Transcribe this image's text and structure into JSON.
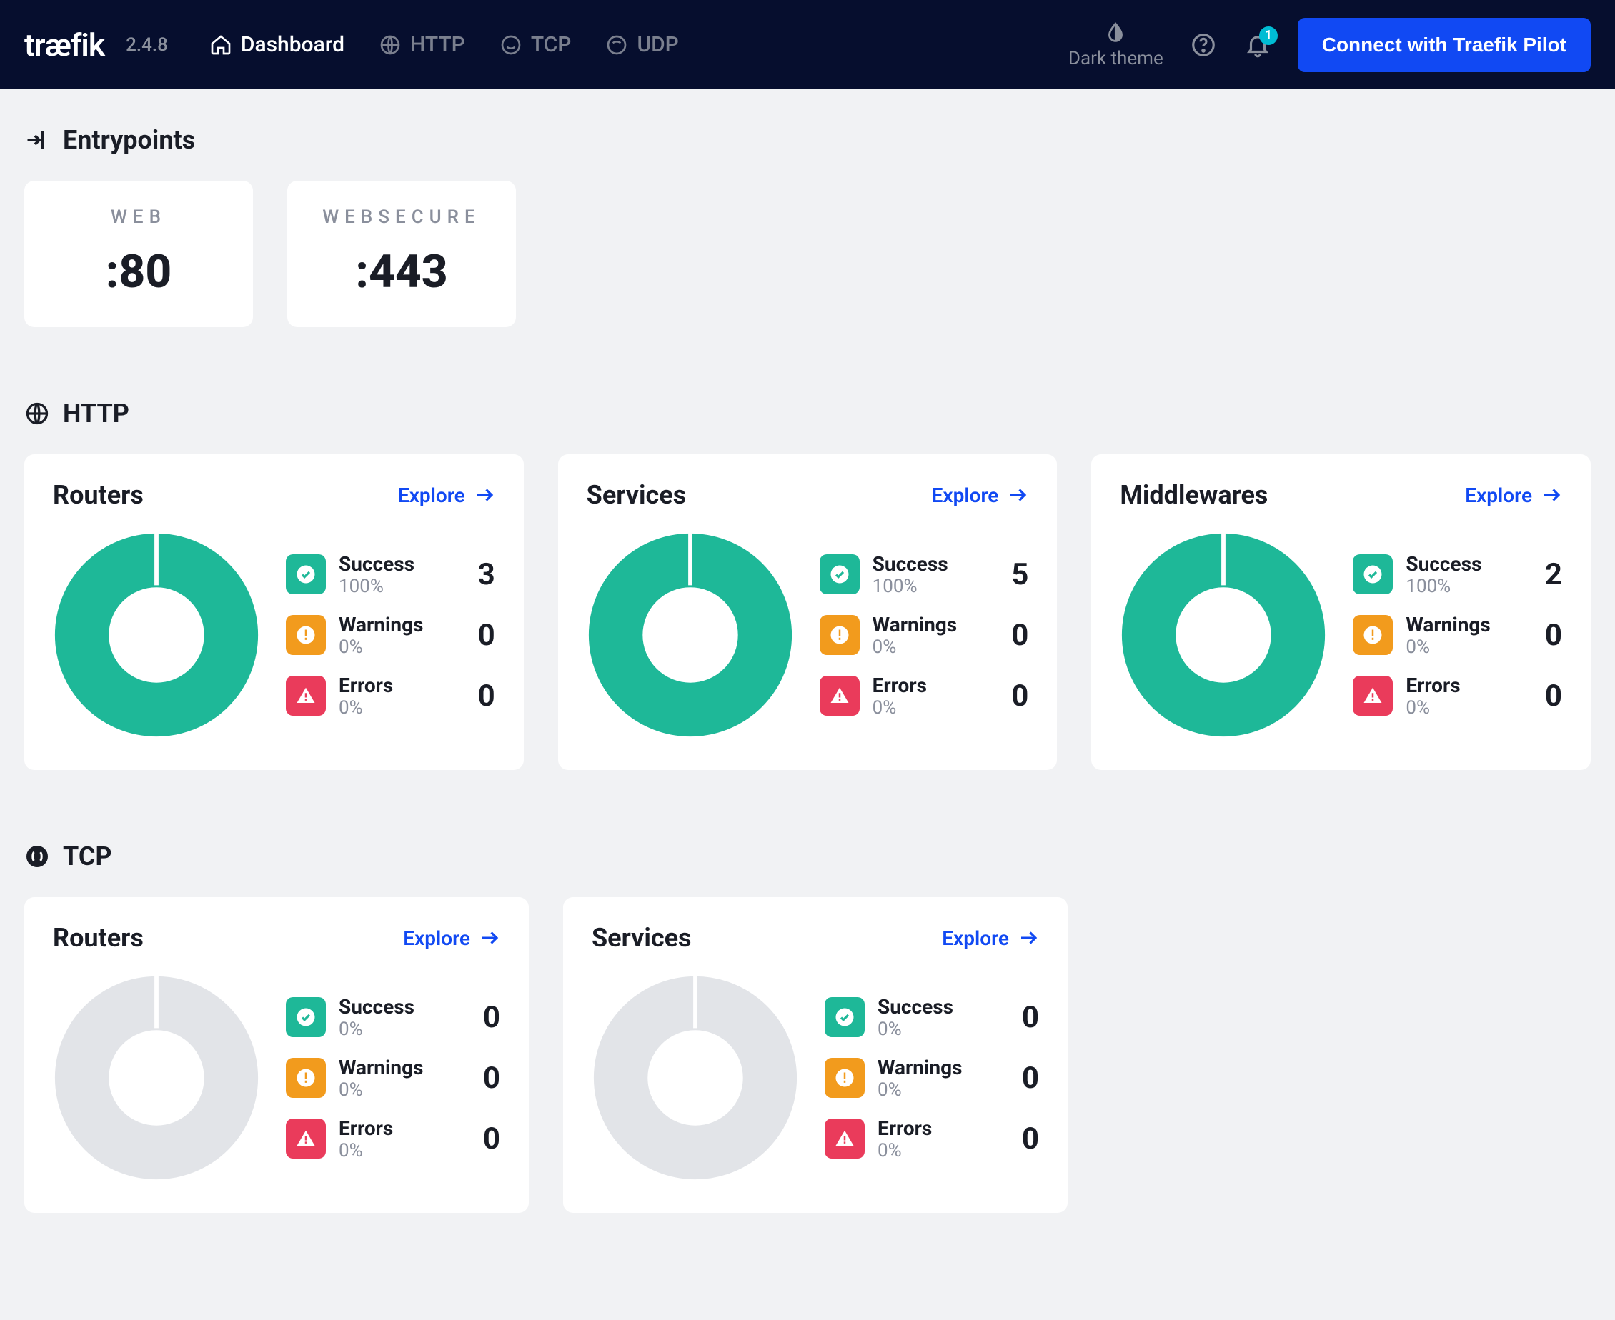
{
  "header": {
    "logo": "træfik",
    "version": "2.4.8",
    "nav": {
      "dashboard": "Dashboard",
      "http": "HTTP",
      "tcp": "TCP",
      "udp": "UDP"
    },
    "theme_label": "Dark theme",
    "notifications_badge": "1",
    "pilot_button": "Connect with Traefik Pilot"
  },
  "sections": {
    "entrypoints": {
      "title": "Entrypoints",
      "items": [
        {
          "name": "WEB",
          "port": ":80"
        },
        {
          "name": "WEBSECURE",
          "port": ":443"
        }
      ]
    },
    "http": {
      "title": "HTTP",
      "cards": [
        {
          "title": "Routers",
          "explore": "Explore",
          "success_label": "Success",
          "success_pct": "100%",
          "success_count": "3",
          "warnings_label": "Warnings",
          "warnings_pct": "0%",
          "warnings_count": "0",
          "errors_label": "Errors",
          "errors_pct": "0%",
          "errors_count": "0",
          "donut_color": "#1eb898"
        },
        {
          "title": "Services",
          "explore": "Explore",
          "success_label": "Success",
          "success_pct": "100%",
          "success_count": "5",
          "warnings_label": "Warnings",
          "warnings_pct": "0%",
          "warnings_count": "0",
          "errors_label": "Errors",
          "errors_pct": "0%",
          "errors_count": "0",
          "donut_color": "#1eb898"
        },
        {
          "title": "Middlewares",
          "explore": "Explore",
          "success_label": "Success",
          "success_pct": "100%",
          "success_count": "2",
          "warnings_label": "Warnings",
          "warnings_pct": "0%",
          "warnings_count": "0",
          "errors_label": "Errors",
          "errors_pct": "0%",
          "errors_count": "0",
          "donut_color": "#1eb898"
        }
      ]
    },
    "tcp": {
      "title": "TCP",
      "cards": [
        {
          "title": "Routers",
          "explore": "Explore",
          "success_label": "Success",
          "success_pct": "0%",
          "success_count": "0",
          "warnings_label": "Warnings",
          "warnings_pct": "0%",
          "warnings_count": "0",
          "errors_label": "Errors",
          "errors_pct": "0%",
          "errors_count": "0",
          "donut_color": "#e2e4e8"
        },
        {
          "title": "Services",
          "explore": "Explore",
          "success_label": "Success",
          "success_pct": "0%",
          "success_count": "0",
          "warnings_label": "Warnings",
          "warnings_pct": "0%",
          "warnings_count": "0",
          "errors_label": "Errors",
          "errors_pct": "0%",
          "errors_count": "0",
          "donut_color": "#e2e4e8"
        }
      ]
    }
  },
  "chart_data": [
    {
      "type": "pie",
      "title": "HTTP Routers",
      "categories": [
        "Success",
        "Warnings",
        "Errors"
      ],
      "values": [
        3,
        0,
        0
      ]
    },
    {
      "type": "pie",
      "title": "HTTP Services",
      "categories": [
        "Success",
        "Warnings",
        "Errors"
      ],
      "values": [
        5,
        0,
        0
      ]
    },
    {
      "type": "pie",
      "title": "HTTP Middlewares",
      "categories": [
        "Success",
        "Warnings",
        "Errors"
      ],
      "values": [
        2,
        0,
        0
      ]
    },
    {
      "type": "pie",
      "title": "TCP Routers",
      "categories": [
        "Success",
        "Warnings",
        "Errors"
      ],
      "values": [
        0,
        0,
        0
      ]
    },
    {
      "type": "pie",
      "title": "TCP Services",
      "categories": [
        "Success",
        "Warnings",
        "Errors"
      ],
      "values": [
        0,
        0,
        0
      ]
    }
  ]
}
